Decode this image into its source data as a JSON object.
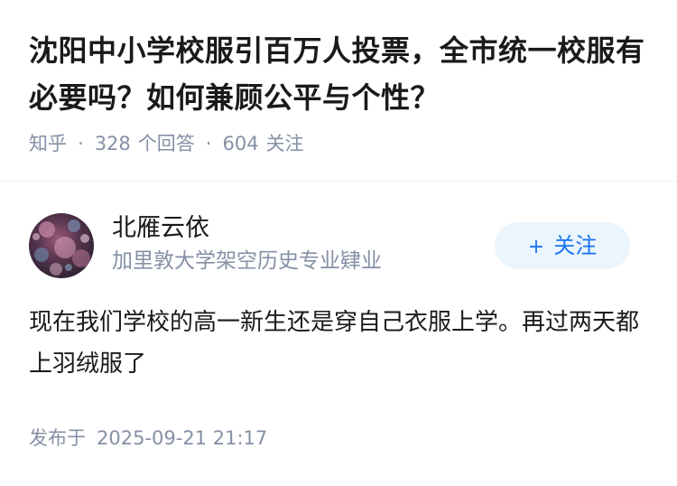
{
  "question": {
    "title": "沈阳中小学校服引百万人投票，全市统一校服有必要吗？如何兼顾公平与个性？",
    "source": "知乎",
    "answer_count": "328",
    "answer_label": "个回答",
    "follower_count": "604",
    "follower_label": "关注",
    "separator": "·"
  },
  "author": {
    "name": "北雁云依",
    "bio": "加里敦大学架空历史专业肄业",
    "avatar_icon": "avatar-image",
    "follow_button_label": "关注",
    "follow_icon": "plus-icon",
    "follow_symbol": "+"
  },
  "answer": {
    "content": "现在我们学校的高一新生还是穿自己衣服上学。再过两天都上羽绒服了",
    "published_label": "发布于",
    "published_time": "2025-09-21 21:17"
  },
  "colors": {
    "title": "#1a1a1a",
    "meta": "#8590a6",
    "follow_bg": "#ebf5fd",
    "follow_text": "#1772f6",
    "divider": "#f0f0f2"
  }
}
